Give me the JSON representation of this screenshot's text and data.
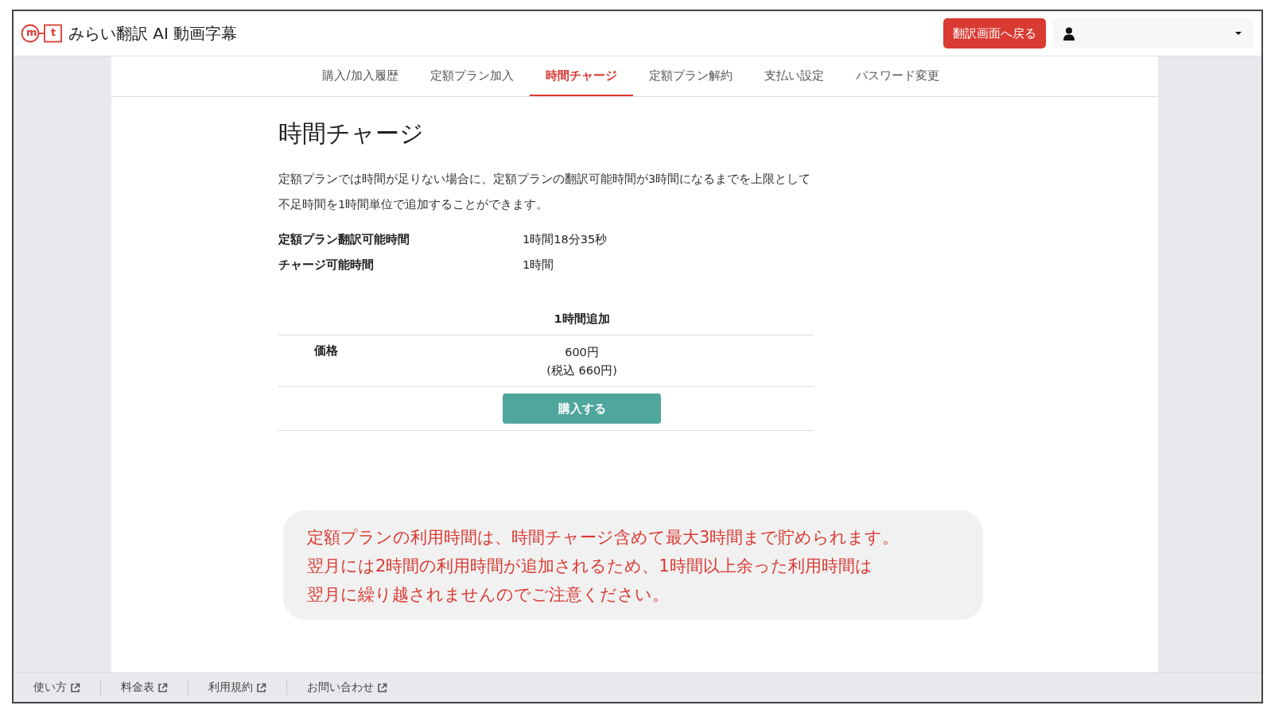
{
  "header": {
    "logo": {
      "m": "m",
      "t": "t"
    },
    "app_name": "みらい翻訳 AI 動画字幕",
    "back_button": "翻訳画面へ戻る"
  },
  "tabs": [
    {
      "label": "購入/加入履歴",
      "selected": false
    },
    {
      "label": "定額プラン加入",
      "selected": false
    },
    {
      "label": "時間チャージ",
      "selected": true
    },
    {
      "label": "定額プラン解約",
      "selected": false
    },
    {
      "label": "支払い設定",
      "selected": false
    },
    {
      "label": "パスワード変更",
      "selected": false
    }
  ],
  "page_title": "時間チャージ",
  "description": [
    "定額プランでは時間が足りない場合に、定額プランの翻訳可能時間が3時間になるまでを上限として",
    "不足時間を1時間単位で追加することができます。"
  ],
  "info": [
    {
      "label": "定額プラン翻訳可能時間",
      "value": "1時間18分35秒"
    },
    {
      "label": "チャージ可能時間",
      "value": "1時間"
    }
  ],
  "plan_table": {
    "heading": "1時間追加",
    "price_label": "価格",
    "price": "600円",
    "price_tax": "(税込 660円)",
    "buy_button": "購入する"
  },
  "notice": [
    "定額プランの利用時間は、時間チャージ含めて最大3時間まで貯められます。",
    "翌月には2時間の利用時間が追加されるため、1時間以上余った利用時間は",
    "翌月に繰り越されませんのでご注意ください。"
  ],
  "footer_links": [
    "使い方",
    "料金表",
    "利用規約",
    "お問い合わせ"
  ]
}
